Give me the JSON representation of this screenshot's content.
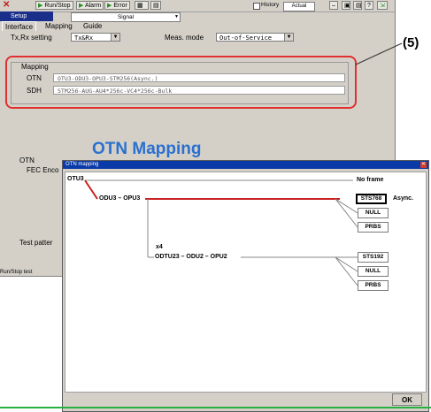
{
  "toolbar": {
    "run_stop": "Run/Stop",
    "alarm": "Alarm",
    "error": "Error",
    "history": "History",
    "history_value": "Actual"
  },
  "titlebar": {
    "title": "Setup",
    "signal": "Signal"
  },
  "tabs": [
    "Interface",
    "Mapping",
    "Guide"
  ],
  "settings": {
    "txrx_label": "Tx,Rx setting",
    "txrx_value": "Tx&Rx",
    "meas_label": "Meas. mode",
    "meas_value": "Out-of-Service"
  },
  "mapping": {
    "heading": "Mapping",
    "otn_label": "OTN",
    "otn_value": "OTU3-ODU3-OPU3-STM256(Async.)",
    "sdh_label": "SDH",
    "sdh_value": "STM256-AUG-AU4*256c-VC4*256c-Bulk"
  },
  "callout": "(5)",
  "lower_labels": {
    "otn": "OTN",
    "fec": "FEC Enco",
    "test_pattern": "Test patter"
  },
  "status": "Run/Stop test",
  "otn_heading": "OTN Mapping",
  "dialog": {
    "title": "OTN mapping",
    "nodes": {
      "otu3": "OTU3",
      "odu3_opu3": "ODU3 – OPU3",
      "x4": "x4",
      "odtu_chain": "ODTU23 – ODU2 – OPU2",
      "async": "Async."
    },
    "top_options": [
      "No frame",
      "STS768",
      "NULL",
      "PRBS"
    ],
    "bottom_options": [
      "STS192",
      "NULL",
      "PRBS"
    ],
    "ok": "OK"
  },
  "colors": {
    "highlight": "#e03030",
    "heading": "#2a70d0",
    "selected_path": "#c82020"
  }
}
